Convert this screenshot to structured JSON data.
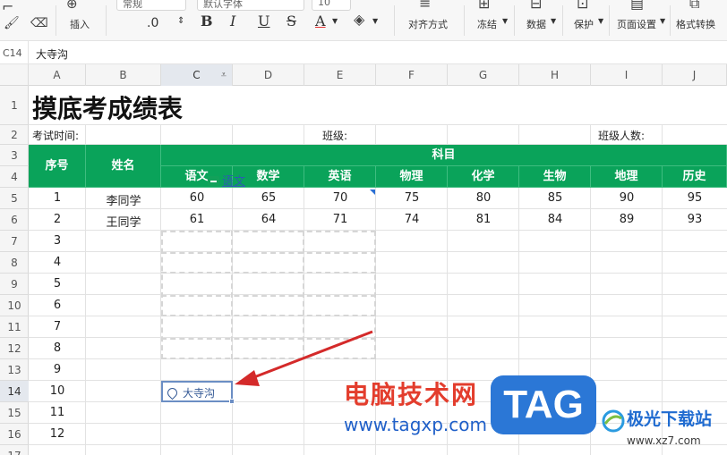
{
  "toolbar": {
    "insert_label": "插入",
    "number_format": "常规",
    "decimal_label": ".0",
    "font_name": "默认字体",
    "font_size": "10",
    "bold": "B",
    "italic": "I",
    "underline": "U",
    "strike": "S",
    "font_color": "A",
    "align_label": "对齐方式",
    "freeze_label": "冻结",
    "data_label": "数据",
    "protect_label": "保护",
    "page_setup_label": "页面设置",
    "convert_label": "格式转换"
  },
  "formula_bar": {
    "cell_ref": "C14",
    "value": "大寺沟"
  },
  "columns": [
    "A",
    "B",
    "C",
    "D",
    "E",
    "F",
    "G",
    "H",
    "I",
    "J"
  ],
  "rows": [
    "1",
    "2",
    "3",
    "4",
    "5",
    "6",
    "7",
    "8",
    "9",
    "10",
    "11",
    "12",
    "13",
    "14",
    "15",
    "16",
    "17"
  ],
  "sheet": {
    "title": "摸底考成绩表",
    "exam_time_label": "考试时间:",
    "class_label": "班级:",
    "class_size_label": "班级人数:",
    "header_no": "序号",
    "header_name": "姓名",
    "header_subjects": "科目",
    "subjects": [
      "语文",
      "数学",
      "英语",
      "物理",
      "化学",
      "生物",
      "地理",
      "历史"
    ],
    "students": [
      {
        "no": "1",
        "name": "李同学",
        "scores": [
          "60",
          "65",
          "70",
          "75",
          "80",
          "85",
          "90",
          "95"
        ]
      },
      {
        "no": "2",
        "name": "王同学",
        "scores": [
          "61",
          "64",
          "71",
          "74",
          "81",
          "84",
          "89",
          "93"
        ]
      }
    ],
    "seq_numbers": [
      "3",
      "4",
      "5",
      "6",
      "7",
      "8",
      "9",
      "10",
      "11",
      "12"
    ],
    "link_chip": "语文",
    "location_chip": "大寺沟"
  },
  "watermark": {
    "site_name": "电脑技术网",
    "site_url": "www.tagxp.com",
    "logo_text": "TAG",
    "partner_name": "极光下载站",
    "partner_url": "www.xz7.com"
  },
  "colors": {
    "header_green": "#0aa35a",
    "arrow_red": "#d42a2a",
    "selection_blue": "#6b8ec4"
  }
}
